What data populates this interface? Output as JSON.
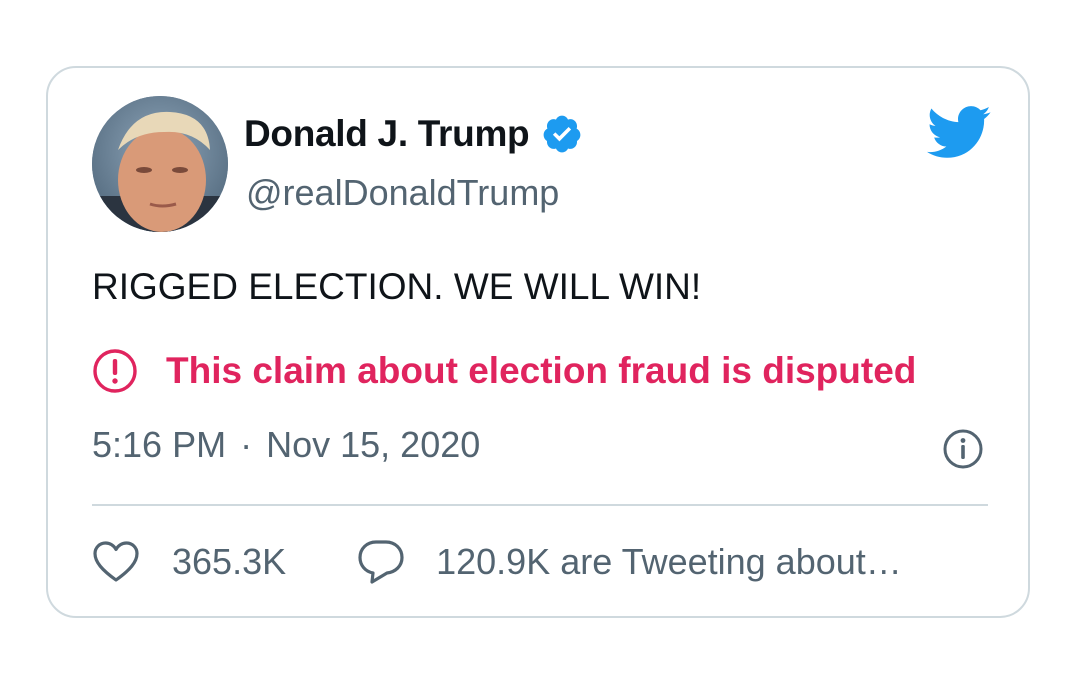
{
  "tweet": {
    "author_name": "Donald J. Trump",
    "author_handle": "@realDonaldTrump",
    "verified": true,
    "text": "RIGGED ELECTION. WE WILL WIN!",
    "notice": "This claim about election fraud is disputed",
    "time": "5:16 PM",
    "separator": "·",
    "date": "Nov 15, 2020",
    "like_count": "365.3K",
    "tweeting_text": "120.9K are Tweeting about…"
  },
  "icons": {
    "brand": "twitter-bird-icon",
    "verified": "verified-badge-icon",
    "notice": "exclamation-circle-icon",
    "info": "info-icon",
    "like": "heart-icon",
    "reply": "speech-bubble-icon"
  },
  "colors": {
    "brand_blue": "#1d9bf0",
    "text_primary": "#0f1419",
    "text_secondary": "#536471",
    "warning_red": "#e0245e",
    "border": "#cfd9de"
  }
}
